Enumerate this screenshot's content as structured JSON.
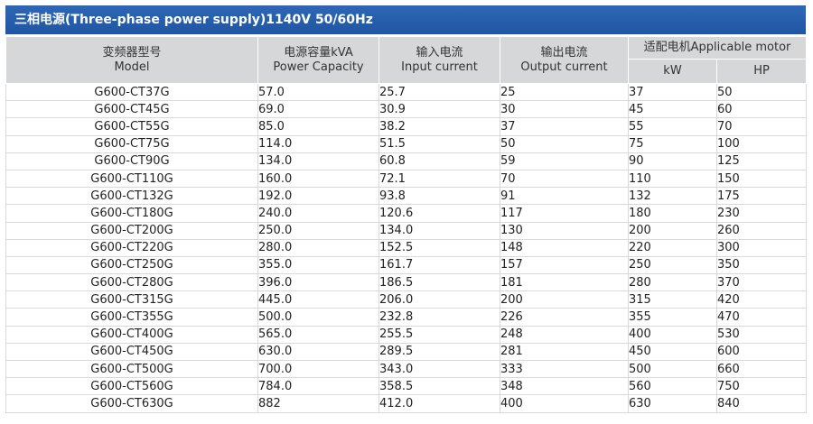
{
  "title": "三相电源(Three-phase power supply)1140V 50/60Hz",
  "headers": {
    "model_cn": "变频器型号",
    "model_en": "Model",
    "capacity_cn": "电源容量kVA",
    "capacity_en": "Power Capacity",
    "input_cn": "输入电流",
    "input_en": "Input current",
    "output_cn": "输出电流",
    "output_en": "Output current",
    "motor_group": "适配电机Applicable motor",
    "kw": "kW",
    "hp": "HP"
  },
  "rows": [
    {
      "model": "G600-CT37G",
      "capacity": "57.0",
      "input": "25.7",
      "output": "25",
      "kw": "37",
      "hp": "50"
    },
    {
      "model": "G600-CT45G",
      "capacity": "69.0",
      "input": "30.9",
      "output": "30",
      "kw": "45",
      "hp": "60"
    },
    {
      "model": "G600-CT55G",
      "capacity": "85.0",
      "input": "38.2",
      "output": "37",
      "kw": "55",
      "hp": "70"
    },
    {
      "model": "G600-CT75G",
      "capacity": "114.0",
      "input": "51.5",
      "output": "50",
      "kw": "75",
      "hp": "100"
    },
    {
      "model": "G600-CT90G",
      "capacity": "134.0",
      "input": "60.8",
      "output": "59",
      "kw": "90",
      "hp": "125"
    },
    {
      "model": "G600-CT110G",
      "capacity": "160.0",
      "input": "72.1",
      "output": "70",
      "kw": "110",
      "hp": "150"
    },
    {
      "model": "G600-CT132G",
      "capacity": "192.0",
      "input": "93.8",
      "output": "91",
      "kw": "132",
      "hp": "175"
    },
    {
      "model": "G600-CT180G",
      "capacity": "240.0",
      "input": "120.6",
      "output": "117",
      "kw": "180",
      "hp": "230"
    },
    {
      "model": "G600-CT200G",
      "capacity": "250.0",
      "input": "134.0",
      "output": "130",
      "kw": "200",
      "hp": "260"
    },
    {
      "model": "G600-CT220G",
      "capacity": "280.0",
      "input": "152.5",
      "output": "148",
      "kw": "220",
      "hp": "300"
    },
    {
      "model": "G600-CT250G",
      "capacity": "355.0",
      "input": "161.7",
      "output": "157",
      "kw": "250",
      "hp": "350"
    },
    {
      "model": "G600-CT280G",
      "capacity": "396.0",
      "input": "186.5",
      "output": "181",
      "kw": "280",
      "hp": "370"
    },
    {
      "model": "G600-CT315G",
      "capacity": "445.0",
      "input": "206.0",
      "output": "200",
      "kw": "315",
      "hp": "420"
    },
    {
      "model": "G600-CT355G",
      "capacity": "500.0",
      "input": "232.8",
      "output": "226",
      "kw": "355",
      "hp": "470"
    },
    {
      "model": "G600-CT400G",
      "capacity": "565.0",
      "input": "255.5",
      "output": "248",
      "kw": "400",
      "hp": "530"
    },
    {
      "model": "G600-CT450G",
      "capacity": "630.0",
      "input": "289.5",
      "output": "281",
      "kw": "450",
      "hp": "600"
    },
    {
      "model": "G600-CT500G",
      "capacity": "700.0",
      "input": "343.0",
      "output": "333",
      "kw": "500",
      "hp": "660"
    },
    {
      "model": "G600-CT560G",
      "capacity": "784.0",
      "input": "358.5",
      "output": "348",
      "kw": "560",
      "hp": "750"
    },
    {
      "model": "G600-CT630G",
      "capacity": "882",
      "input": "412.0",
      "output": "400",
      "kw": "630",
      "hp": "840"
    }
  ],
  "colors": {
    "title_bar": "#1f56a3",
    "header_bg": "#d6d7d9",
    "grid_line": "#d9d9d9"
  }
}
